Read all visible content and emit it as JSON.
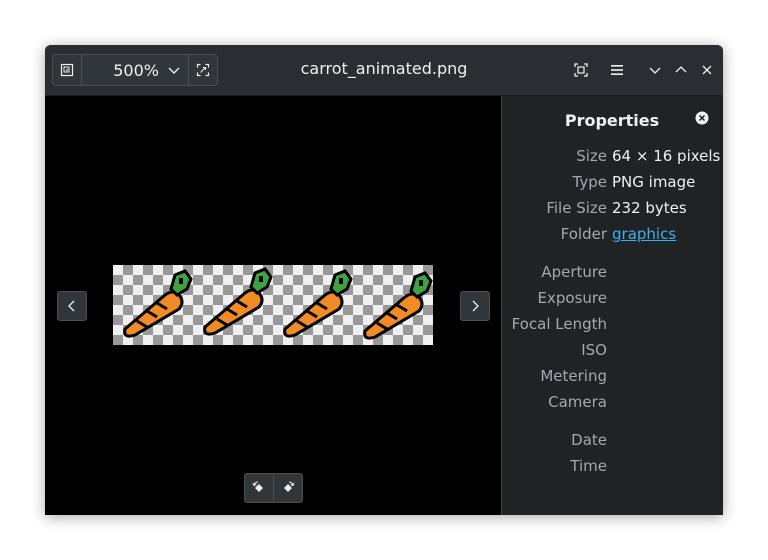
{
  "window": {
    "title": "carrot_animated.png"
  },
  "toolbar": {
    "zoom_value": "500%"
  },
  "properties": {
    "title": "Properties",
    "rows": [
      {
        "label": "Size",
        "value": "64 × 16 pixels"
      },
      {
        "label": "Type",
        "value": "PNG image"
      },
      {
        "label": "File Size",
        "value": "232 bytes"
      },
      {
        "label": "Folder",
        "value": "graphics"
      },
      {
        "label": "Aperture",
        "value": ""
      },
      {
        "label": "Exposure",
        "value": ""
      },
      {
        "label": "Focal Length",
        "value": ""
      },
      {
        "label": "ISO",
        "value": ""
      },
      {
        "label": "Metering",
        "value": ""
      },
      {
        "label": "Camera",
        "value": ""
      },
      {
        "label": "Date",
        "value": ""
      },
      {
        "label": "Time",
        "value": ""
      }
    ]
  },
  "icons": {
    "zoom_fit": "zoom-fit-icon",
    "zoom_fill": "zoom-fill-icon",
    "fullscreen": "fullscreen-icon",
    "menu": "hamburger-menu-icon",
    "minimize": "minimize-icon",
    "maximize": "maximize-icon",
    "close": "close-icon",
    "prev": "chevron-left-icon",
    "next": "chevron-right-icon",
    "rotate_left": "rotate-left-icon",
    "rotate_right": "rotate-right-icon"
  },
  "colors": {
    "link": "#3daee9",
    "header_bg": "#2a2e32",
    "panel_bg": "#202326",
    "carrot": "#f08b25",
    "leaf": "#3ea340"
  }
}
